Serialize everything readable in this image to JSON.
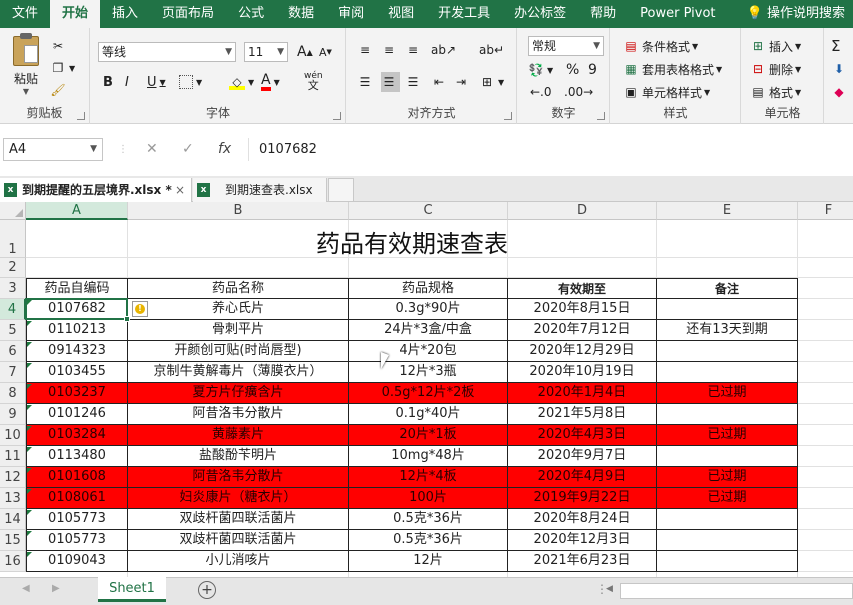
{
  "ribbon_tabs": [
    "文件",
    "开始",
    "插入",
    "页面布局",
    "公式",
    "数据",
    "审阅",
    "视图",
    "开发工具",
    "办公标签",
    "帮助",
    "Power Pivot"
  ],
  "active_tab": "开始",
  "help_search": "操作说明搜索",
  "clipboard": {
    "paste": "粘贴",
    "label": "剪贴板"
  },
  "font": {
    "name": "等线",
    "size": "11",
    "label": "字体",
    "grow": "A",
    "shrink": "A",
    "bold": "B",
    "italic": "I",
    "underline": "U",
    "phonetic": "wén",
    "font_color_letter": "A"
  },
  "alignment": {
    "label": "对齐方式"
  },
  "number": {
    "format": "常规",
    "label": "数字",
    "percent": "%",
    "comma": "9"
  },
  "styles": {
    "conditional": "条件格式",
    "table": "套用表格格式",
    "cell": "单元格样式",
    "label": "样式"
  },
  "cells": {
    "insert": "插入",
    "delete": "删除",
    "format": "格式",
    "label": "单元格"
  },
  "formula_bar": {
    "name_box": "A4",
    "fx": "fx",
    "value": "0107682"
  },
  "workbook_tabs": [
    "到期提醒的五层境界.xlsx *",
    "到期速查表.xlsx"
  ],
  "workbook_close": "×",
  "columns": [
    "A",
    "B",
    "C",
    "D",
    "E",
    "F"
  ],
  "selected_column": "A",
  "selected_row": "4",
  "sheet": {
    "title": "药品有效期速查表",
    "headers": [
      "药品自编码",
      "药品名称",
      "药品规格",
      "有效期至",
      "备注"
    ],
    "rows": [
      {
        "r": "4",
        "code": "0107682",
        "name": "养心氏片",
        "spec": "0.3g*90片",
        "exp": "2020年8月15日",
        "note": "",
        "red": false
      },
      {
        "r": "5",
        "code": "0110213",
        "name": "骨刺平片",
        "spec": "24片*3盒/中盒",
        "exp": "2020年7月12日",
        "note": "还有13天到期",
        "red": false
      },
      {
        "r": "6",
        "code": "0914323",
        "name": "开颜创可贴(时尚唇型)",
        "spec": "4片*20包",
        "exp": "2020年12月29日",
        "note": "",
        "red": false
      },
      {
        "r": "7",
        "code": "0103455",
        "name": "京制牛黄解毒片（薄膜衣片）",
        "spec": "12片*3瓶",
        "exp": "2020年10月19日",
        "note": "",
        "red": false
      },
      {
        "r": "8",
        "code": "0103237",
        "name": "夏方片仔癀含片",
        "spec": "0.5g*12片*2板",
        "exp": "2020年1月4日",
        "note": "已过期",
        "red": true
      },
      {
        "r": "9",
        "code": "0101246",
        "name": "阿昔洛韦分散片",
        "spec": "0.1g*40片",
        "exp": "2021年5月8日",
        "note": "",
        "red": false
      },
      {
        "r": "10",
        "code": "0103284",
        "name": "黄藤素片",
        "spec": "20片*1板",
        "exp": "2020年4月3日",
        "note": "已过期",
        "red": true
      },
      {
        "r": "11",
        "code": "0113480",
        "name": "盐酸酚苄明片",
        "spec": "10mg*48片",
        "exp": "2020年9月7日",
        "note": "",
        "red": false
      },
      {
        "r": "12",
        "code": "0101608",
        "name": "阿昔洛韦分散片",
        "spec": "12片*4板",
        "exp": "2020年4月9日",
        "note": "已过期",
        "red": true
      },
      {
        "r": "13",
        "code": "0108061",
        "name": "妇炎康片（糖衣片）",
        "spec": "100片",
        "exp": "2019年9月22日",
        "note": "已过期",
        "red": true
      },
      {
        "r": "14",
        "code": "0105773",
        "name": "双歧杆菌四联活菌片",
        "spec": "0.5克*36片",
        "exp": "2020年8月24日",
        "note": "",
        "red": false
      },
      {
        "r": "15",
        "code": "0105773",
        "name": "双歧杆菌四联活菌片",
        "spec": "0.5克*36片",
        "exp": "2020年12月3日",
        "note": "",
        "red": false
      },
      {
        "r": "16",
        "code": "0109043",
        "name": "小儿消咳片",
        "spec": "12片",
        "exp": "2021年6月23日",
        "note": "",
        "red": false
      }
    ]
  },
  "sheet_tab": "Sheet1",
  "colors": {
    "excel_green": "#217346",
    "expired_red": "#ff0000"
  }
}
